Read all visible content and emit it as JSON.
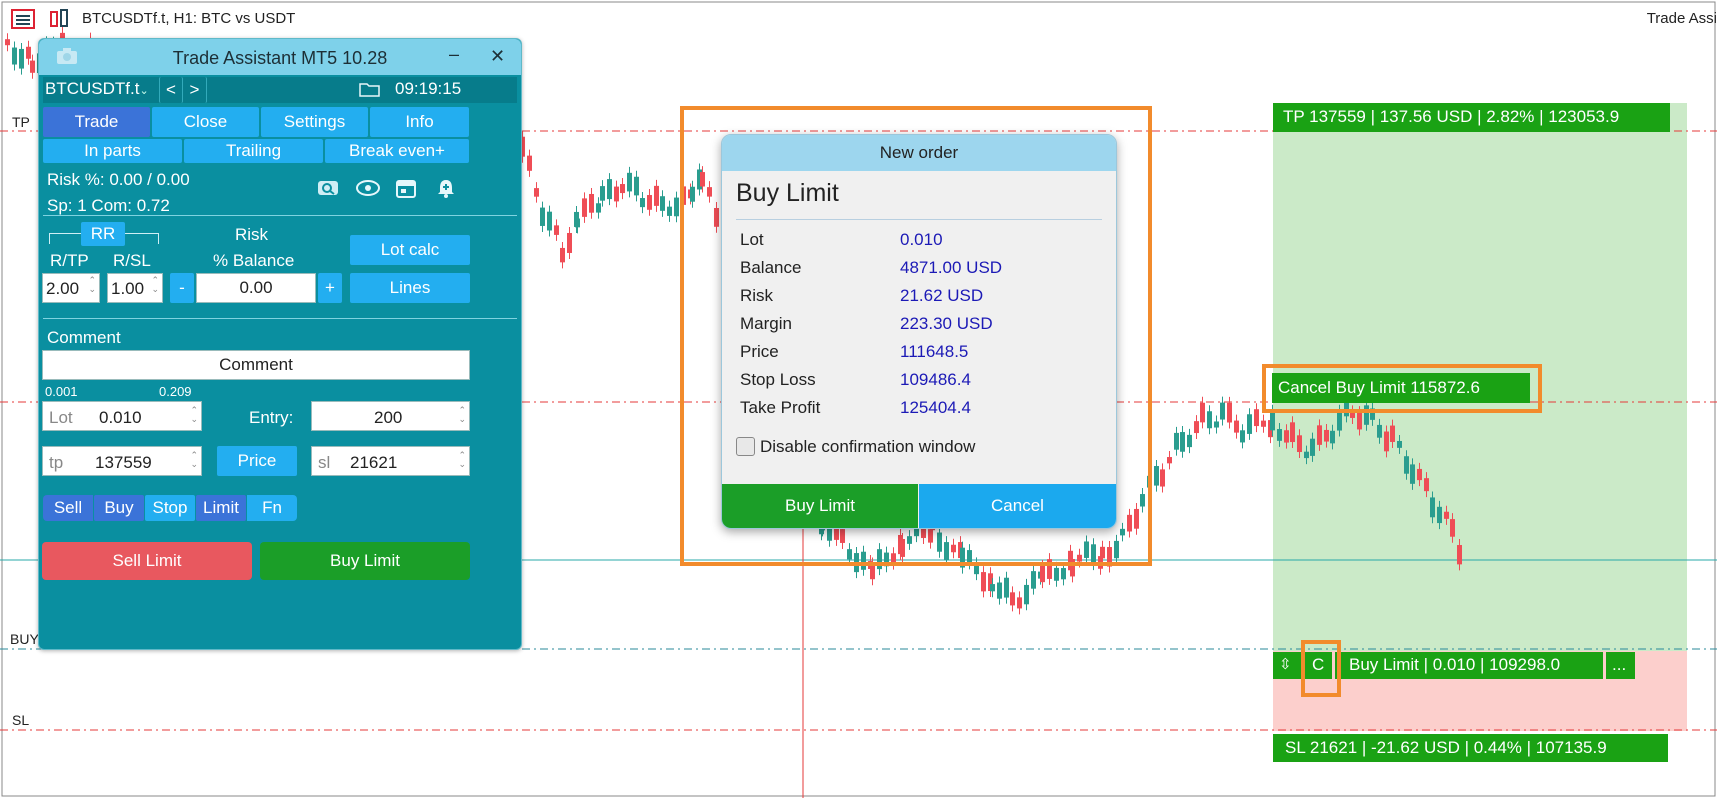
{
  "chart": {
    "symbol_title": "BTCUSDTf.t, H1:  BTC vs USDT",
    "right_title": "Trade Assi",
    "level_tp": "TP",
    "level_buy": "BUY",
    "level_sl": "SL",
    "tp_label": "TP 137559 | 137.56 USD | 2.82% | 123053.9",
    "cancel_label": "Cancel Buy Limit 115872.6",
    "order_move_glyph": "⇳",
    "order_c": "C",
    "order_label": "Buy Limit | 0.010 | 109298.0",
    "order_more": "...",
    "sl_label": "SL 21621 | -21.62 USD | 0.44% | 107135.9",
    "colors": {
      "tp_zone": "#cbeac8",
      "sl_zone": "#fccfcc",
      "tag_green": "#1aa214",
      "bull": "#2a9d8f",
      "bear": "#ef4d56",
      "highlight": "#f28b2c"
    }
  },
  "panel": {
    "title": "Trade Assistant MT5 10.28",
    "minimize": "–",
    "close": "✕",
    "symbol": "BTCUSDTf.t",
    "prev": "<",
    "next": ">",
    "time": "09:19:15",
    "tabs": [
      "Trade",
      "Close",
      "Settings",
      "Info"
    ],
    "subtabs": [
      "In parts",
      "Trailing",
      "Break even+"
    ],
    "risk_line": "Risk %: 0.00 /  0.00",
    "sp_line": "Sp: 1  Com: 0.72",
    "rr_label": "RR",
    "rtp_label": "R/TP",
    "rsl_label": "R/SL",
    "rtp_value": "2.00",
    "rsl_value": "1.00",
    "risk_label": "Risk",
    "risk_balance_label": "% Balance",
    "risk_value": "0.00",
    "minus": "-",
    "plus": "+",
    "lot_calc": "Lot calc",
    "lines": "Lines",
    "comment_label": "Comment",
    "comment_value": "Comment",
    "lot_min": "0.001",
    "lot_max": "0.209",
    "lot_label": "Lot",
    "lot_value": "0.010",
    "entry_label": "Entry:",
    "entry_value": "200",
    "tp_label": "tp",
    "tp_value": "137559",
    "price_button": "Price",
    "sl_label": "sl",
    "sl_value": "21621",
    "types": [
      "Sell",
      "Buy",
      "Stop",
      "Limit",
      "Fn"
    ],
    "sell_limit": "Sell Limit",
    "buy_limit": "Buy Limit"
  },
  "dialog": {
    "title": "New order",
    "heading": "Buy Limit",
    "rows": [
      {
        "k": "Lot",
        "v": "0.010"
      },
      {
        "k": "Balance",
        "v": "4871.00 USD"
      },
      {
        "k": "Risk",
        "v": "21.62 USD"
      },
      {
        "k": "Margin",
        "v": "223.30 USD"
      },
      {
        "k": "Price",
        "v": "111648.5"
      },
      {
        "k": "Stop Loss",
        "v": "109486.4"
      },
      {
        "k": "Take Profit",
        "v": "125404.4"
      }
    ],
    "checkbox_label": "Disable confirmation window",
    "confirm": "Buy Limit",
    "cancel": "Cancel"
  }
}
